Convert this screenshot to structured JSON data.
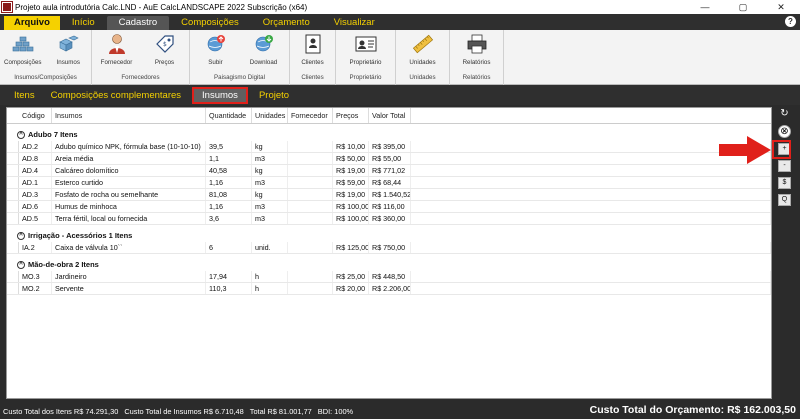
{
  "window": {
    "title": "Projeto aula introdutória Calc.LND - AuE CalcLANDSCAPE 2022 Subscrição (x64)",
    "min": "—",
    "max": "▢",
    "close": "✕"
  },
  "menu": [
    "Arquivo",
    "Início",
    "Cadastro",
    "Composições",
    "Orçamento",
    "Visualizar"
  ],
  "menu_active": "Cadastro",
  "help": "?",
  "ribbon": {
    "groups": [
      {
        "label": "Insumos/Composições",
        "buttons": [
          {
            "label": "Composições",
            "icon": "bricks-icon"
          },
          {
            "label": "Insumos",
            "icon": "cubes-icon"
          }
        ]
      },
      {
        "label": "Fornecedores",
        "buttons": [
          {
            "label": "Fornecedor",
            "icon": "person-icon"
          },
          {
            "label": "Preços",
            "icon": "price-tag-icon"
          }
        ]
      },
      {
        "label": "Paisagismo Digital",
        "buttons": [
          {
            "label": "Subir",
            "icon": "globe-upload-icon"
          },
          {
            "label": "Download",
            "icon": "globe-download-icon"
          }
        ]
      },
      {
        "label": "Clientes",
        "buttons": [
          {
            "label": "Clientes",
            "icon": "contact-card-icon"
          }
        ]
      },
      {
        "label": "Proprietário",
        "buttons": [
          {
            "label": "Proprietário",
            "icon": "id-card-icon"
          }
        ]
      },
      {
        "label": "Unidades",
        "buttons": [
          {
            "label": "Unidades",
            "icon": "ruler-icon"
          }
        ]
      },
      {
        "label": "Relatórios",
        "buttons": [
          {
            "label": "Relatórios",
            "icon": "printer-icon"
          }
        ]
      }
    ]
  },
  "subtabs": [
    "Itens",
    "Composições complementares",
    "Insumos",
    "Projeto"
  ],
  "subtab_active": "Insumos",
  "table": {
    "columns": [
      "Código",
      "Insumos",
      "Quantidade",
      "Unidades",
      "Fornecedor",
      "Preços",
      "Valor Total"
    ],
    "groups": [
      {
        "title": "Adubo  7 Itens",
        "rows": [
          [
            "AD.2",
            "Adubo químico NPK, fórmula base (10-10-10)",
            "39,5",
            "kg",
            "",
            "R$ 10,00",
            "R$ 395,00"
          ],
          [
            "AD.8",
            "Areia média",
            "1,1",
            "m3",
            "",
            "R$ 50,00",
            "R$ 55,00"
          ],
          [
            "AD.4",
            "Calcáreo dolomítico",
            "40,58",
            "kg",
            "",
            "R$ 19,00",
            "R$ 771,02"
          ],
          [
            "AD.1",
            "Esterco curtido",
            "1,16",
            "m3",
            "",
            "R$ 59,00",
            "R$ 68,44"
          ],
          [
            "AD.3",
            "Fosfato de rocha ou semelhante",
            "81,08",
            "kg",
            "",
            "R$ 19,00",
            "R$ 1.540,52"
          ],
          [
            "AD.6",
            "Humus de minhoca",
            "1,16",
            "m3",
            "",
            "R$ 100,00",
            "R$ 116,00"
          ],
          [
            "AD.5",
            "Terra fértil, local ou fornecida",
            "3,6",
            "m3",
            "",
            "R$ 100,00",
            "R$ 360,00"
          ]
        ]
      },
      {
        "title": "Irrigação - Acessórios  1 Itens",
        "rows": [
          [
            "IA.2",
            "Caixa de válvula 10``",
            "6",
            "unid.",
            "",
            "R$ 125,00",
            "R$ 750,00"
          ]
        ]
      },
      {
        "title": "Mão-de-obra  2 Itens",
        "rows": [
          [
            "MO.3",
            "Jardineiro",
            "17,94",
            "h",
            "",
            "R$ 25,00",
            "R$ 448,50"
          ],
          [
            "MO.2",
            "Servente",
            "110,3",
            "h",
            "",
            "R$ 20,00",
            "R$ 2.206,00"
          ]
        ]
      }
    ]
  },
  "side_buttons": [
    "↻",
    "⊗",
    "+",
    "-",
    "$",
    "Q"
  ],
  "status": {
    "items": [
      "Custo Total dos Itens R$ 74.291,30",
      "Custo Total de Insumos R$ 6.710,48",
      "Total R$ 81.001,77",
      "BDI: 100%"
    ],
    "total": "Custo Total do Orçamento: R$ 162.003,50"
  },
  "colors": {
    "accent": "#f5d100",
    "highlight": "#e0201a",
    "dark": "#2f2f2f"
  }
}
